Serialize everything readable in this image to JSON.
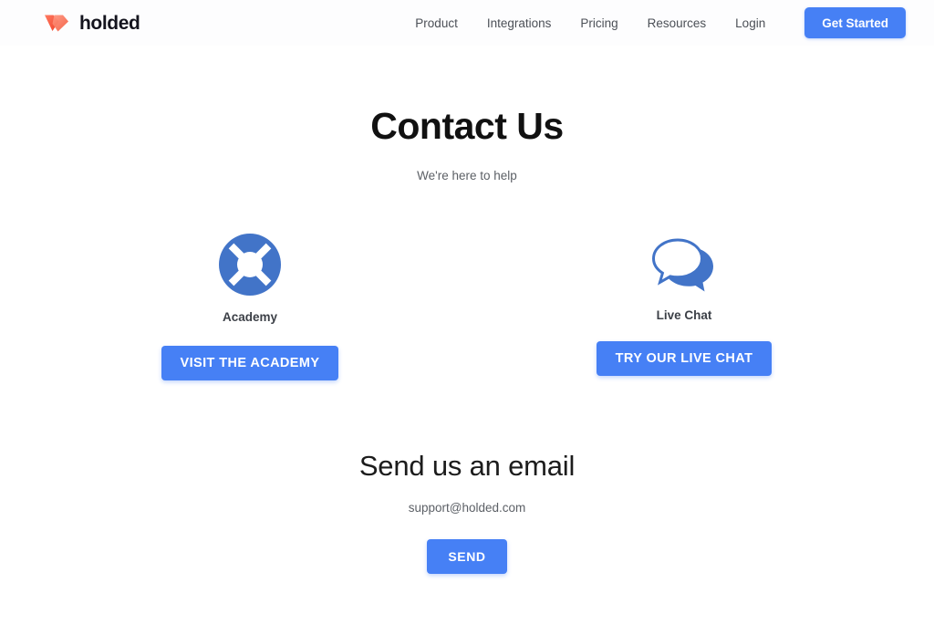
{
  "header": {
    "brand": {
      "name": "holded",
      "logo_icon": "holded-diamond-logo-icon",
      "logo_color": "#f4593c"
    },
    "nav": [
      {
        "label": "Product"
      },
      {
        "label": "Integrations"
      },
      {
        "label": "Pricing"
      },
      {
        "label": "Resources"
      },
      {
        "label": "Login"
      }
    ],
    "cta": {
      "label": "Get Started"
    }
  },
  "hero": {
    "title": "Contact Us",
    "subtitle": "We're here to help"
  },
  "channels": [
    {
      "icon": "lifebuoy-icon",
      "label": "Academy",
      "button_label": "VISIT THE ACADEMY"
    },
    {
      "icon": "speech-bubbles-icon",
      "label": "Live Chat",
      "button_label": "TRY OUR LIVE CHAT"
    }
  ],
  "email_section": {
    "title": "Send us an email",
    "address": "support@holded.com",
    "button_label": "SEND"
  },
  "colors": {
    "accent_blue": "#4680f5",
    "icon_blue": "#4274c8",
    "brand_red": "#f4593c",
    "text_dark": "#111111",
    "text_muted": "#5c6066"
  }
}
